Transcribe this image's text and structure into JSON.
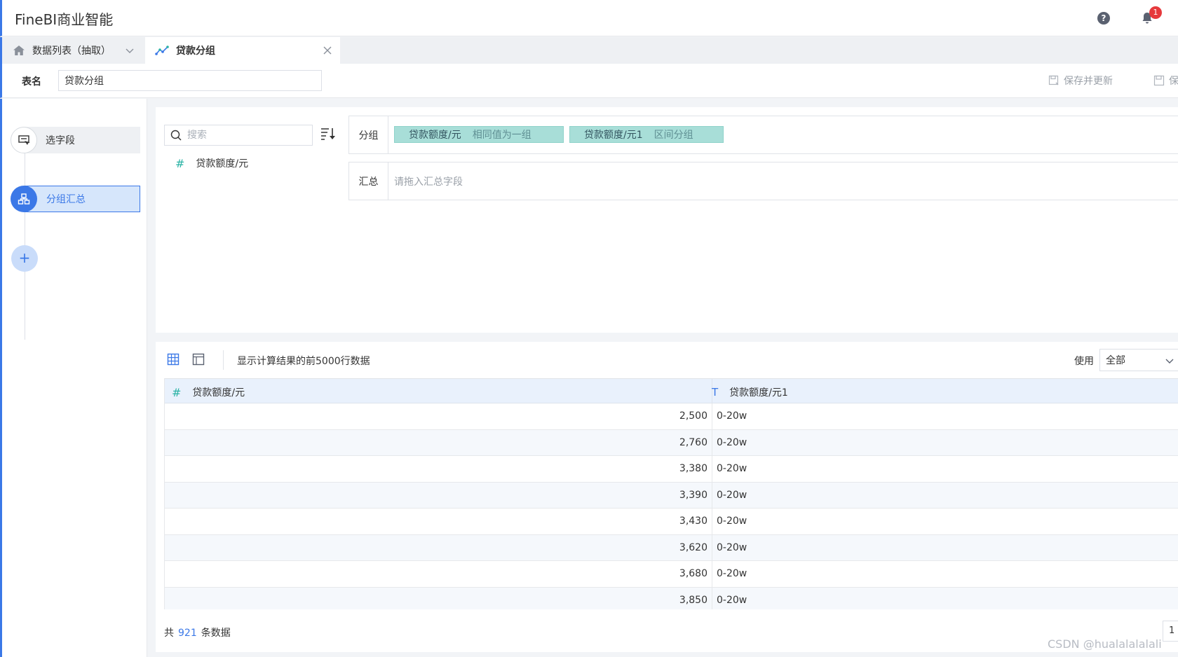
{
  "app": {
    "title": "FineBI商业智能",
    "notification_count": "1"
  },
  "tabs": [
    {
      "label": "数据列表（抽取）"
    },
    {
      "label": "贷款分组"
    }
  ],
  "namebar": {
    "label": "表名",
    "value": "贷款分组",
    "save_update_label": "保存并更新",
    "save_label": "保"
  },
  "steps": [
    {
      "label": "选字段"
    },
    {
      "label": "分组汇总"
    }
  ],
  "step_add_symbol": "+",
  "fields": {
    "search_placeholder": "搜索",
    "items": [
      {
        "type_symbol": "#",
        "name": "贷款额度/元"
      }
    ]
  },
  "group": {
    "label": "分组",
    "chips": [
      {
        "field": "贷款额度/元",
        "method": "相同值为一组"
      },
      {
        "field": "贷款额度/元1",
        "method": "区间分组"
      }
    ]
  },
  "summary": {
    "label": "汇总",
    "placeholder": "请拖入汇总字段"
  },
  "preview": {
    "description": "显示计算结果的前5000行数据",
    "use_label": "使用",
    "use_value": "全部",
    "columns": [
      {
        "type_symbol": "#",
        "name": "贷款额度/元"
      },
      {
        "type_symbol": "T",
        "name": "贷款额度/元1"
      }
    ],
    "rows": [
      [
        "2,500",
        "0-20w"
      ],
      [
        "2,760",
        "0-20w"
      ],
      [
        "3,380",
        "0-20w"
      ],
      [
        "3,390",
        "0-20w"
      ],
      [
        "3,430",
        "0-20w"
      ],
      [
        "3,620",
        "0-20w"
      ],
      [
        "3,680",
        "0-20w"
      ],
      [
        "3,850",
        "0-20w"
      ]
    ],
    "total_prefix": "共",
    "total_count": "921",
    "total_suffix": "条数据",
    "page": "1"
  },
  "watermark": "CSDN @hualalalalali",
  "colors": {
    "accent": "#3b78e7",
    "chip_bg": "#a8ded8",
    "badge": "#e6393c",
    "number_type": "#2bb3a5"
  }
}
